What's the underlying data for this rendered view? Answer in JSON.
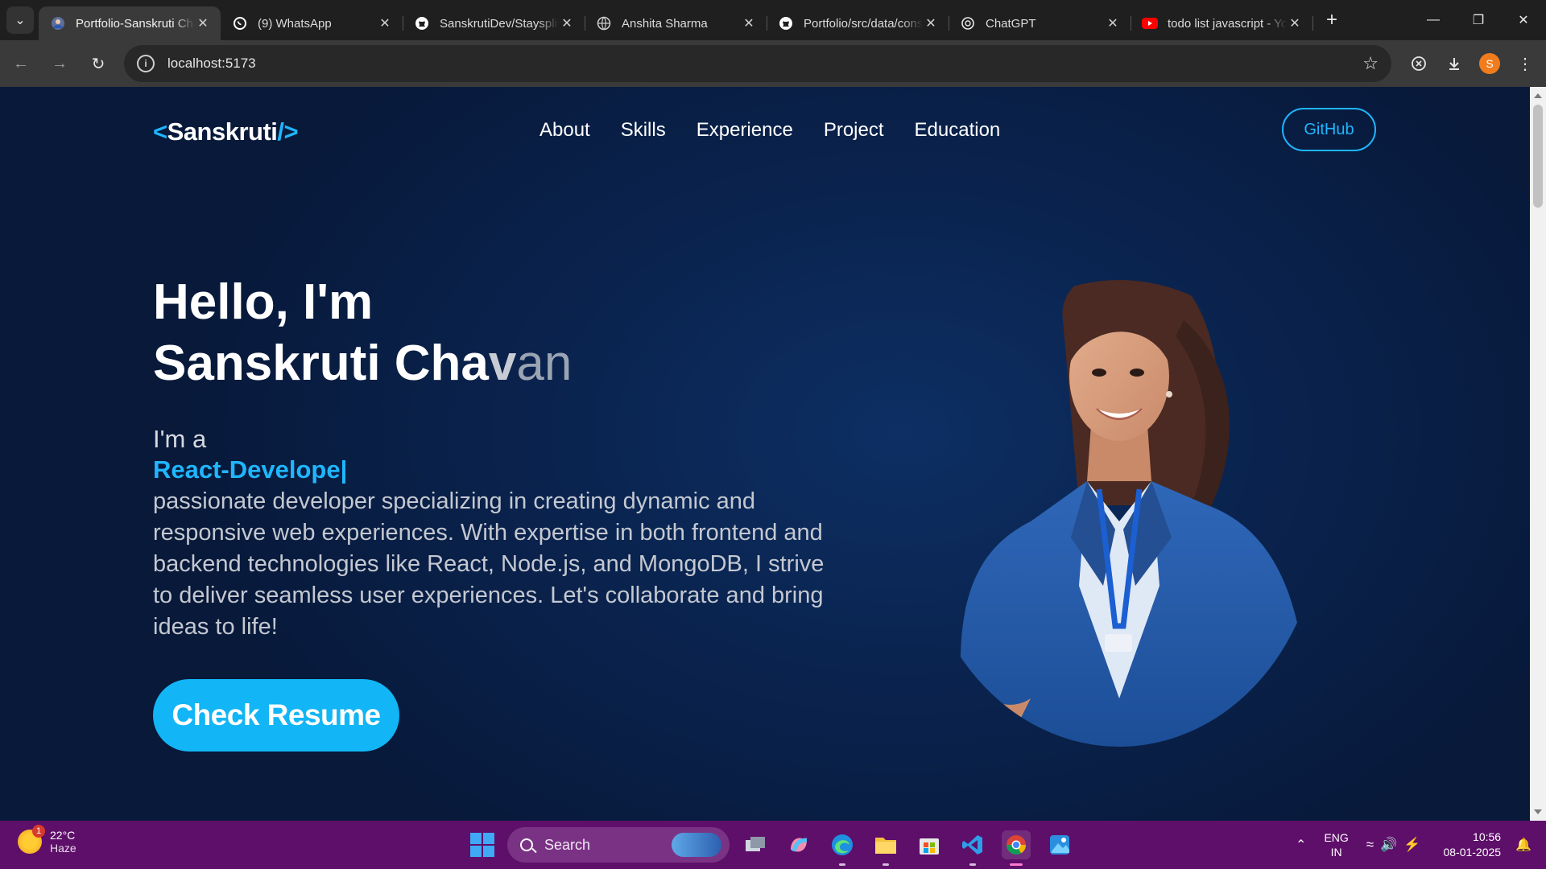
{
  "browser": {
    "tabs": [
      {
        "title": "Portfolio-Sanskruti Chavan",
        "icon": "portfolio-favicon",
        "active": true
      },
      {
        "title": "(9) WhatsApp",
        "icon": "whatsapp-icon",
        "active": false
      },
      {
        "title": "SanskrutiDev/Staysplit",
        "icon": "github-icon",
        "active": false
      },
      {
        "title": "Anshita Sharma",
        "icon": "globe-icon",
        "active": false
      },
      {
        "title": "Portfolio/src/data/constants",
        "icon": "github-icon",
        "active": false
      },
      {
        "title": "ChatGPT",
        "icon": "chatgpt-icon",
        "active": false
      },
      {
        "title": "todo list javascript - YouTube",
        "icon": "youtube-icon",
        "active": false
      }
    ],
    "address": "localhost:5173",
    "profile_initial": "S"
  },
  "page": {
    "logo": {
      "open": "<",
      "name": "Sanskruti",
      "close": "/>"
    },
    "nav": [
      "About",
      "Skills",
      "Experience",
      "Project",
      "Education"
    ],
    "github_label": "GitHub",
    "hero": {
      "greeting": "Hello, I'm",
      "name_solid": "Sanskruti Cha",
      "name_mid": "v",
      "name_fade": "an",
      "im_a": "I'm a",
      "role": "React-Develope|",
      "description": "passionate developer specializing in creating dynamic and responsive web experiences. With expertise in both frontend and backend technologies like React, Node.js, and MongoDB, I strive to deliver seamless user experiences. Let's collaborate and bring ideas to life!",
      "resume_label": "Check Resume"
    },
    "accent_color": "#1fb6ff"
  },
  "taskbar": {
    "weather": {
      "temp": "22°C",
      "condition": "Haze",
      "badge": "1"
    },
    "search_placeholder": "Search",
    "apps": [
      "task-view-icon",
      "copilot-icon",
      "edge-icon",
      "file-explorer-icon",
      "microsoft-store-icon",
      "vscode-icon",
      "chrome-icon",
      "photos-icon"
    ],
    "lang_line1": "ENG",
    "lang_line2": "IN",
    "time": "10:56",
    "date": "08-01-2025"
  }
}
